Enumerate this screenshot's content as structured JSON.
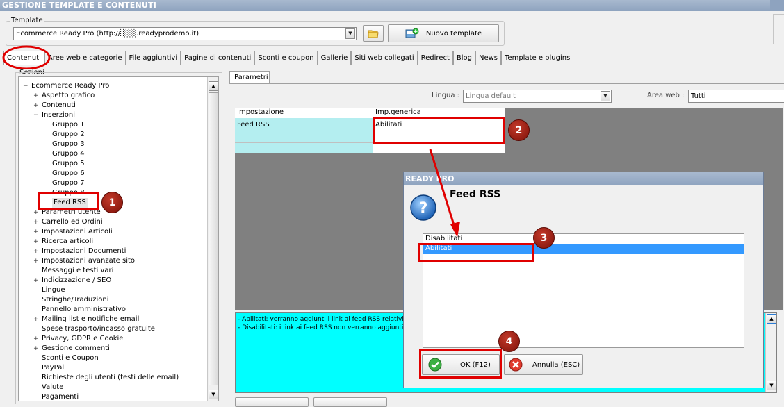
{
  "window": {
    "title": "GESTIONE TEMPLATE E CONTENUTI"
  },
  "template_group": {
    "label": "Template",
    "selected": "Ecommerce Ready Pro (http://░░░.readyprodemo.it)",
    "new_template_button": "Nuovo template"
  },
  "tabs": [
    {
      "label": "Contenuti",
      "active": true
    },
    {
      "label": "Aree web e categorie"
    },
    {
      "label": "File aggiuntivi"
    },
    {
      "label": "Pagine di contenuti"
    },
    {
      "label": "Sconti e coupon"
    },
    {
      "label": "Gallerie"
    },
    {
      "label": "Siti web collegati"
    },
    {
      "label": "Redirect"
    },
    {
      "label": "Blog"
    },
    {
      "label": "News"
    },
    {
      "label": "Template e plugins"
    }
  ],
  "sections": {
    "label": "Sezioni",
    "items": [
      {
        "label": "Ecommerce Ready Pro",
        "level": 0,
        "expander": "minus"
      },
      {
        "label": "Aspetto grafico",
        "level": 1,
        "expander": "plus"
      },
      {
        "label": "Contenuti",
        "level": 1,
        "expander": "plus"
      },
      {
        "label": "Inserzioni",
        "level": 1,
        "expander": "minus"
      },
      {
        "label": "Gruppo 1",
        "level": 2
      },
      {
        "label": "Gruppo 2",
        "level": 2
      },
      {
        "label": "Gruppo 3",
        "level": 2
      },
      {
        "label": "Gruppo 4",
        "level": 2
      },
      {
        "label": "Gruppo 5",
        "level": 2
      },
      {
        "label": "Gruppo 6",
        "level": 2
      },
      {
        "label": "Gruppo 7",
        "level": 2
      },
      {
        "label": "Gruppo 8",
        "level": 2
      },
      {
        "label": "Feed RSS",
        "level": 2,
        "selected": true
      },
      {
        "label": "Parametri utente",
        "level": 1,
        "expander": "plus"
      },
      {
        "label": "Carrello ed Ordini",
        "level": 1,
        "expander": "plus"
      },
      {
        "label": "Impostazioni Articoli",
        "level": 1,
        "expander": "plus"
      },
      {
        "label": "Ricerca articoli",
        "level": 1,
        "expander": "plus"
      },
      {
        "label": "Impostazioni Documenti",
        "level": 1,
        "expander": "plus"
      },
      {
        "label": "Impostazioni avanzate sito",
        "level": 1,
        "expander": "plus"
      },
      {
        "label": "Messaggi e testi vari",
        "level": 1
      },
      {
        "label": "Indicizzazione / SEO",
        "level": 1,
        "expander": "plus"
      },
      {
        "label": "Lingue",
        "level": 1
      },
      {
        "label": "Stringhe/Traduzioni",
        "level": 1
      },
      {
        "label": "Pannello amministrativo",
        "level": 1
      },
      {
        "label": "Mailing list e notifiche email",
        "level": 1,
        "expander": "plus"
      },
      {
        "label": "Spese trasporto/incasso gratuite",
        "level": 1
      },
      {
        "label": "Privacy, GDPR e Cookie",
        "level": 1,
        "expander": "plus"
      },
      {
        "label": "Gestione commenti",
        "level": 1,
        "expander": "plus"
      },
      {
        "label": "Sconti e Coupon",
        "level": 1
      },
      {
        "label": "PayPal",
        "level": 1
      },
      {
        "label": "Richieste degli utenti (testi delle email)",
        "level": 1
      },
      {
        "label": "Valute",
        "level": 1
      },
      {
        "label": "Pagamenti",
        "level": 1
      }
    ]
  },
  "params": {
    "tab_label": "Parametri",
    "lingua_label": "Lingua :",
    "lingua_value": "Lingua default",
    "area_label": "Area web :",
    "area_value": "Tutti",
    "grid": {
      "headers": [
        "Impostazione",
        "Imp.generica"
      ],
      "rows": [
        [
          "Feed RSS",
          "Abilitati"
        ]
      ]
    },
    "description": [
      "- Abilitati: verranno aggiunti i link ai feed RSS relativi",
      "- Disabilitati: i link ai feed RSS non verranno aggiunti"
    ]
  },
  "dialog": {
    "title": "READY PRO",
    "heading": "Feed RSS",
    "options": [
      "Disabilitati",
      "Abilitati"
    ],
    "selected": "Abilitati",
    "ok_button": "OK (F12)",
    "cancel_button": "Annulla (ESC)"
  },
  "callouts": [
    "1",
    "2",
    "3",
    "4"
  ],
  "colors": {
    "highlight": "#e00000",
    "selection": "#3399ff",
    "description_bg": "#00ffff",
    "grid_bg": "#808080"
  }
}
